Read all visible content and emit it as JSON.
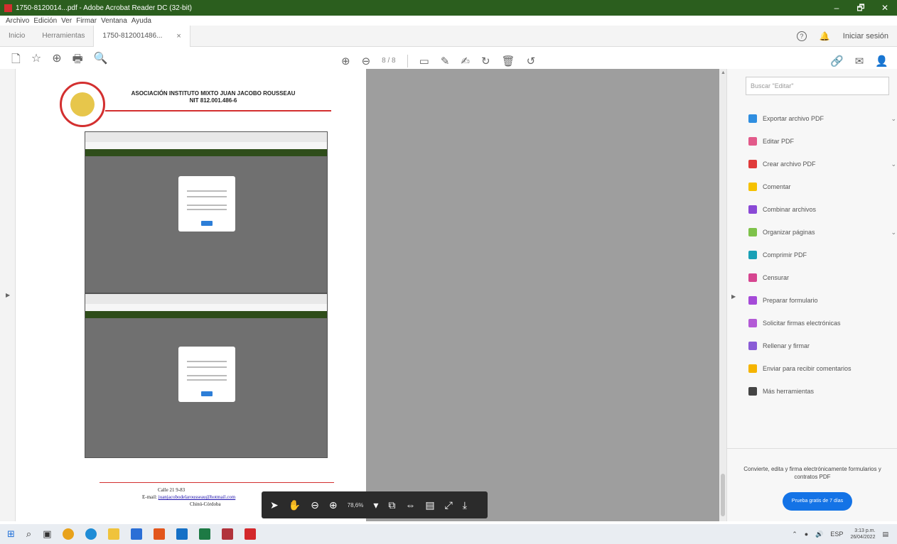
{
  "window": {
    "title": "1750-8120014...pdf - Adobe Acrobat Reader DC (32-bit)",
    "min": "–",
    "max": "🗗",
    "close": "✕"
  },
  "menu": [
    "Archivo",
    "Edición",
    "Ver",
    "Firmar",
    "Ventana",
    "Ayuda"
  ],
  "tabs": {
    "home": "Inicio",
    "tools": "Herramientas",
    "document": "1750-812001486...",
    "close": "×"
  },
  "header": {
    "help": "?",
    "signin": "Iniciar sesión"
  },
  "toolbar": {
    "page_indicator": "8 / 8"
  },
  "document": {
    "org_name": "ASOCIACIÓN INSTITUTO MIXTO JUAN JACOBO ROUSSEAU",
    "nit": "NIT 812.001.486-6",
    "footer_address": "Calle 21 9-83",
    "footer_email_label": "E-mail: ",
    "footer_email": "juanjacobodelarousseau@hotmail.com",
    "footer_city": "Chinú-Córdoba"
  },
  "floatbar": {
    "zoom": "78,6%"
  },
  "rightpane": {
    "search_placeholder": "Buscar \"Editar\"",
    "tools": [
      {
        "label": "Exportar archivo PDF",
        "color": "#2f8ee0",
        "expand": true
      },
      {
        "label": "Editar PDF",
        "color": "#e25a8a",
        "expand": false
      },
      {
        "label": "Crear archivo PDF",
        "color": "#e03a3a",
        "expand": true
      },
      {
        "label": "Comentar",
        "color": "#f5c100",
        "expand": false
      },
      {
        "label": "Combinar archivos",
        "color": "#8a49d6",
        "expand": false
      },
      {
        "label": "Organizar páginas",
        "color": "#7ec24a",
        "expand": true
      },
      {
        "label": "Comprimir PDF",
        "color": "#19a0b6",
        "expand": false
      },
      {
        "label": "Censurar",
        "color": "#d64590",
        "expand": false
      },
      {
        "label": "Preparar formulario",
        "color": "#a54ad8",
        "expand": false
      },
      {
        "label": "Solicitar firmas electrónicas",
        "color": "#b35ad6",
        "expand": false
      },
      {
        "label": "Rellenar y firmar",
        "color": "#8a5cd6",
        "expand": false
      },
      {
        "label": "Enviar para recibir comentarios",
        "color": "#f5b400",
        "expand": false
      },
      {
        "label": "Más herramientas",
        "color": "#444444",
        "expand": false
      }
    ],
    "promo": "Convierte, edita y firma electrónicamente formularios y contratos PDF",
    "try_button": "Prueba gratis de 7 días"
  },
  "taskbar": {
    "lang": "ESP",
    "time": "3:13 p.m.",
    "date": "26/04/2022"
  }
}
